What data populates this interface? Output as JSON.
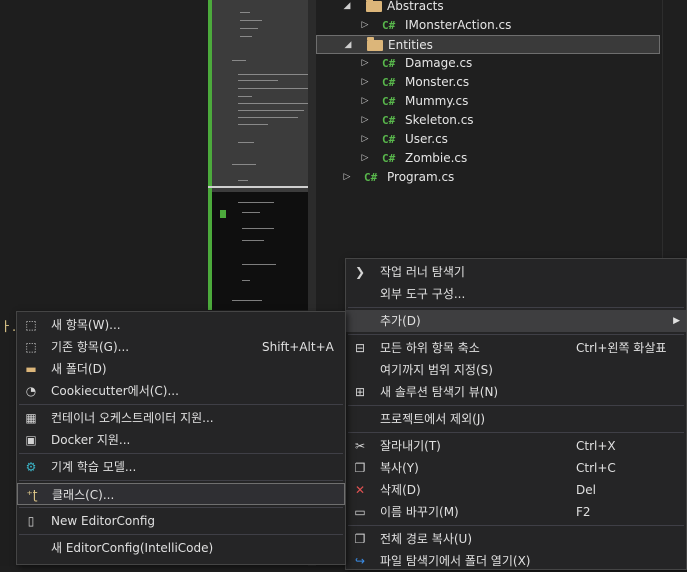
{
  "tree": {
    "rows": [
      {
        "type": "folder",
        "label": "Abstracts"
      },
      {
        "type": "file",
        "label": "IMonsterAction.cs"
      },
      {
        "type": "folder",
        "label": "Entities"
      },
      {
        "type": "file",
        "label": "Damage.cs"
      },
      {
        "type": "file",
        "label": "Monster.cs"
      },
      {
        "type": "file",
        "label": "Mummy.cs"
      },
      {
        "type": "file",
        "label": "Skeleton.cs"
      },
      {
        "type": "file",
        "label": "User.cs"
      },
      {
        "type": "file",
        "label": "Zombie.cs"
      },
      {
        "type": "file",
        "label": "Program.cs"
      }
    ],
    "file_badge": "C#"
  },
  "stray_text": "ㅏ.",
  "context_menu": {
    "items": [
      {
        "label": "작업 러너 탐색기",
        "shortcut": "",
        "icon": "chevron-right-icon"
      },
      {
        "label": "외부 도구 구성...",
        "shortcut": "",
        "icon": ""
      },
      {
        "label": "추가(D)",
        "shortcut": "",
        "icon": "",
        "submenu": true
      },
      {
        "label": "모든 하위 항목 축소",
        "shortcut": "Ctrl+왼쪽 화살표",
        "icon": "collapse-icon"
      },
      {
        "label": "여기까지 범위 지정(S)",
        "shortcut": "",
        "icon": ""
      },
      {
        "label": "새 솔루션 탐색기 뷰(N)",
        "shortcut": "",
        "icon": "new-view-icon"
      },
      {
        "label": "프로젝트에서 제외(J)",
        "shortcut": "",
        "icon": ""
      },
      {
        "label": "잘라내기(T)",
        "shortcut": "Ctrl+X",
        "icon": "cut-icon"
      },
      {
        "label": "복사(Y)",
        "shortcut": "Ctrl+C",
        "icon": "copy-icon"
      },
      {
        "label": "삭제(D)",
        "shortcut": "Del",
        "icon": "delete-icon"
      },
      {
        "label": "이름 바꾸기(M)",
        "shortcut": "F2",
        "icon": "rename-icon"
      },
      {
        "label": "전체 경로 복사(U)",
        "shortcut": "",
        "icon": "copy-path-icon"
      },
      {
        "label": "파일 탐색기에서 폴더 열기(X)",
        "shortcut": "",
        "icon": "open-folder-icon"
      }
    ]
  },
  "add_submenu": {
    "items": [
      {
        "label": "새 항목(W)...",
        "shortcut": "",
        "icon": "new-item-icon"
      },
      {
        "label": "기존 항목(G)...",
        "shortcut": "Shift+Alt+A",
        "icon": "existing-item-icon"
      },
      {
        "label": "새 폴더(D)",
        "shortcut": "",
        "icon": "new-folder-icon"
      },
      {
        "label": "Cookiecutter에서(C)...",
        "shortcut": "",
        "icon": "cookiecutter-icon"
      },
      {
        "label": "컨테이너 오케스트레이터 지원...",
        "shortcut": "",
        "icon": "container-icon"
      },
      {
        "label": "Docker 지원...",
        "shortcut": "",
        "icon": "docker-icon"
      },
      {
        "label": "기계 학습 모델...",
        "shortcut": "",
        "icon": "ml-model-icon"
      },
      {
        "label": "클래스(C)...",
        "shortcut": "",
        "icon": "class-icon"
      },
      {
        "label": "New EditorConfig",
        "shortcut": "",
        "icon": "editorconfig-icon"
      },
      {
        "label": "새 EditorConfig(IntelliCode)",
        "shortcut": "",
        "icon": ""
      }
    ]
  },
  "colors": {
    "accent_green": "#4caa3c",
    "folder": "#dcb67a",
    "delete_red": "#e05252",
    "cog_teal": "#3bb6c9"
  }
}
